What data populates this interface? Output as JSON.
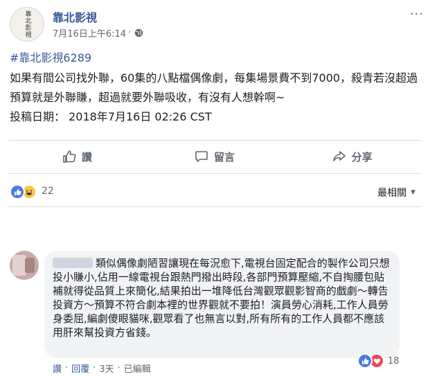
{
  "post": {
    "page_name": "靠北影視",
    "date": "7月16日上午6:14",
    "meta_separator": "·",
    "privacy_icon": "globe-icon",
    "more_label": "···",
    "avatar_logo": "靠北影視",
    "hashtag": "#靠北影視6289",
    "body_line1": "如果有間公司找外聯，60集的八點檔偶像劇，每集場景費不到7000，殺青若沒超過預算就是外聯賺，超過就要外聯吸收，有沒有人想幹啊~",
    "body_line2": "投稿日期： 2018年7月16日 02:26 CST"
  },
  "actions": {
    "like_label": "讚",
    "comment_label": "留言",
    "share_label": "分享"
  },
  "reactions": {
    "count": "22",
    "types": [
      "like",
      "haha"
    ],
    "sort_label": "最相關",
    "sort_arrow": "▼"
  },
  "comment": {
    "text": "類似偶像劇陋習讓現在每況愈下,電視台固定配合的製作公司只想投小賺小,佔用一線電視台跟熱門撥出時段,各部門預算壓縮,不自掏腰包貼補就得從品質上來簡化,結果拍出一堆降低台灣觀眾觀影智商的戲劇～轉告投資方～預算不符合劇本裡的世界觀就不要拍！演員勞心消耗,工作人員勞身委屈,編劇傻眼貓咪,觀眾看了也無言以對,所有所有的工作人員都不應該用肝來幫投資方省錢。",
    "reaction_count": "18",
    "reaction_types": [
      "like",
      "love"
    ],
    "like_label": "讚",
    "reply_label": "回覆",
    "time": "3天",
    "edited": "已編輯",
    "separator": "·"
  },
  "colors": {
    "link": "#385898",
    "like": "#4a7bd9",
    "love": "#f0475c",
    "haha": "#f7c84a",
    "bubble": "#f2f3f5"
  }
}
